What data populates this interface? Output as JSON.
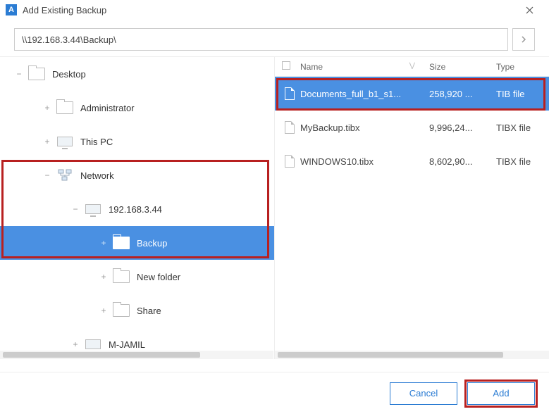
{
  "window": {
    "title": "Add Existing Backup",
    "app_letter": "A"
  },
  "path": {
    "value": "\\\\192.168.3.44\\Backup\\"
  },
  "tree": {
    "desktop": "Desktop",
    "administrator": "Administrator",
    "this_pc": "This PC",
    "network": "Network",
    "ip_node": "192.168.3.44",
    "backup": "Backup",
    "new_folder": "New folder",
    "share": "Share",
    "m_jamil": "M-JAMIL"
  },
  "file_list": {
    "headers": {
      "name": "Name",
      "size": "Size",
      "type": "Type"
    },
    "rows": [
      {
        "name": "Documents_full_b1_s1...",
        "size": "258,920 ...",
        "type": "TIB file"
      },
      {
        "name": "MyBackup.tibx",
        "size": "9,996,24...",
        "type": "TIBX file"
      },
      {
        "name": "WINDOWS10.tibx",
        "size": "8,602,90...",
        "type": "TIBX file"
      }
    ]
  },
  "buttons": {
    "cancel": "Cancel",
    "add": "Add"
  }
}
